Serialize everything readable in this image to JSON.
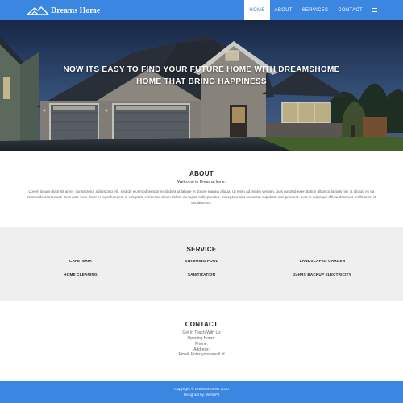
{
  "nav": {
    "brand": "Dreams Home",
    "links": [
      "HOME",
      "ABOUT",
      "SERVICES",
      "CONTACT"
    ],
    "active": "HOME"
  },
  "hero": {
    "line1": "NOW ITS EASY TO FIND YOUR FUTURE HOME WITH DREAMSHOME",
    "line2": "HOME THAT BRING HAPPINESS"
  },
  "about": {
    "title": "ABOUT",
    "subtitle": "Welcome to DreamsHome.",
    "text": "Lorem ipsum dolor sit amet, consectetur adipisicing elit, sed do eiusmod tempor incididunt ut labore et dolore magna aliqua. Ut enim ad minim veniam, quis nostrud exercitation ullamco laboris nisi ut aliquip ex ea commodo consequat. Duis aute irure dolor in reprehenderit in voluptate velit esse cillum dolore eu fugiat nulla pariatur. Excepteur sint occaecat cupidatat non proident, sunt in culpa qui officia deserunt mollit anim id est laborum."
  },
  "service": {
    "title": "SERVICE",
    "items": [
      "CAFETERIA",
      "SWIMMING POOL",
      "LANDSCAPED GARDEN",
      "HOME CLEANING",
      "SANITIZATION",
      "24HRS BACKUP ELECTRICITY"
    ]
  },
  "contact": {
    "title": "CONTACT",
    "lines": [
      "Get In Touch With Us",
      "Opening Hours:",
      "Phone:",
      "Address:",
      "Email: Enter your email id"
    ]
  },
  "footer": {
    "copyright": "Copyright © DreamsHomes 2020",
    "designed": "Designed by: WebsFit"
  },
  "colors": {
    "navbar": "#3b86e0",
    "footer": "#3b86e0",
    "service_bg": "#efefef"
  }
}
